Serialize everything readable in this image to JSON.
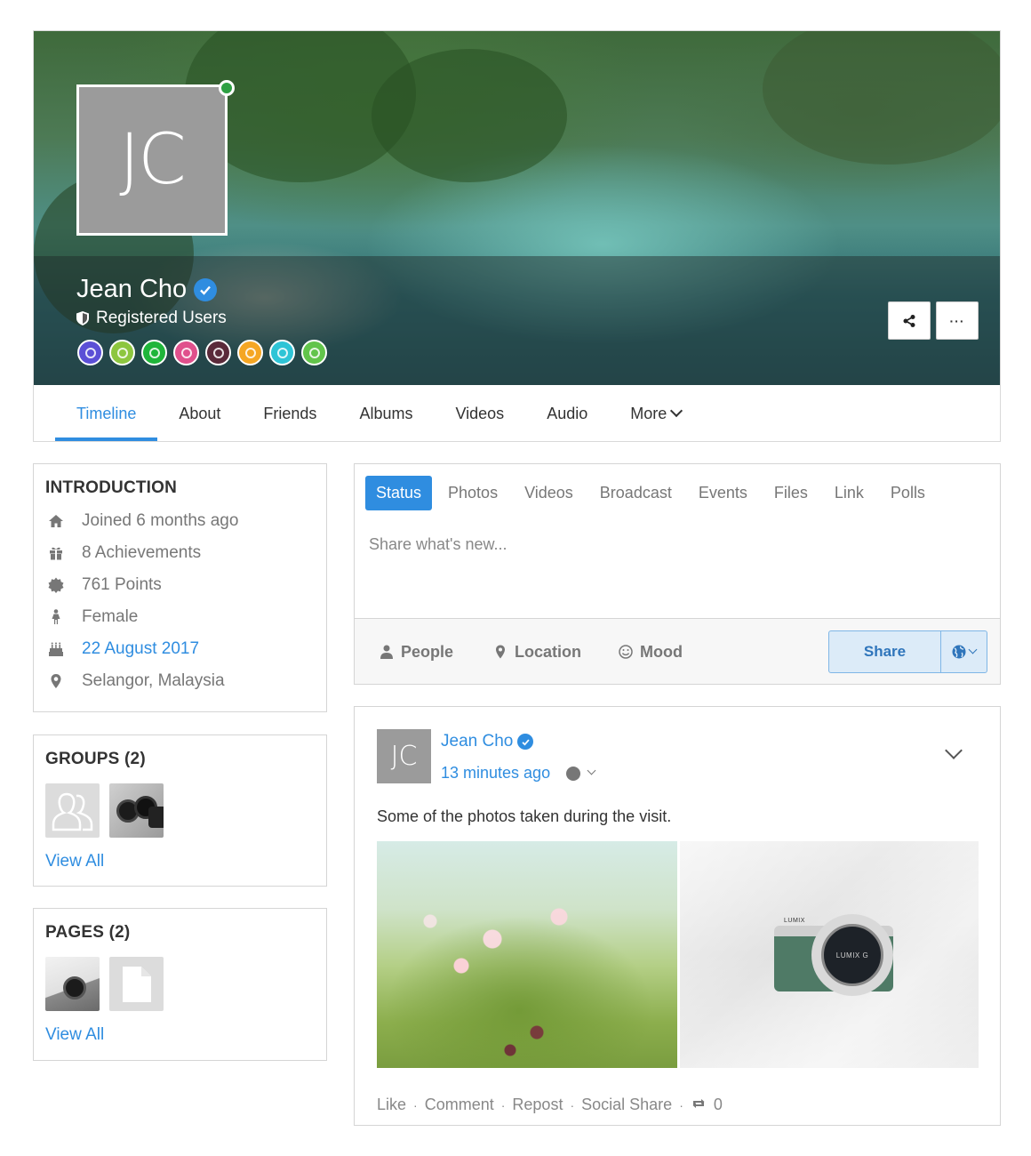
{
  "profile": {
    "initials": "JC",
    "name": "Jean Cho",
    "role": "Registered Users",
    "badge_colors": [
      "#5b4fd6",
      "#8dc63f",
      "#1fb53a",
      "#e0508c",
      "#5a2a3a",
      "#f5a623",
      "#2ec4d6",
      "#62c44b"
    ],
    "online_color": "#2ea043"
  },
  "cover_actions": {
    "share_icon": "share-icon",
    "more_label": "···"
  },
  "nav": {
    "tabs": [
      "Timeline",
      "About",
      "Friends",
      "Albums",
      "Videos",
      "Audio",
      "More"
    ],
    "active": "Timeline"
  },
  "introduction": {
    "title": "INTRODUCTION",
    "items": [
      {
        "icon": "home-icon",
        "text": "Joined 6 months ago"
      },
      {
        "icon": "gift-icon",
        "text": "8 Achievements"
      },
      {
        "icon": "badge-icon",
        "text": "761 Points"
      },
      {
        "icon": "female-icon",
        "text": "Female"
      },
      {
        "icon": "cake-icon",
        "text": "22 August 2017"
      },
      {
        "icon": "map-pin-icon",
        "text": "Selangor, Malaysia"
      }
    ]
  },
  "groups": {
    "title": "GROUPS (2)",
    "view_all": "View All"
  },
  "pages": {
    "title": "PAGES (2)",
    "view_all": "View All"
  },
  "composer": {
    "tabs": [
      "Status",
      "Photos",
      "Videos",
      "Broadcast",
      "Events",
      "Files",
      "Link",
      "Polls"
    ],
    "active_tab": "Status",
    "placeholder": "Share what's new...",
    "people_label": "People",
    "location_label": "Location",
    "mood_label": "Mood",
    "share_label": "Share"
  },
  "post": {
    "initials": "JC",
    "author": "Jean Cho",
    "time": "13 minutes ago",
    "text": "Some of the photos taken during the visit.",
    "camera_brand": "LUMIX",
    "camera_lens": "LUMIX G",
    "actions": {
      "like": "Like",
      "comment": "Comment",
      "repost": "Repost",
      "social_share": "Social Share",
      "repost_count": "0"
    }
  },
  "colors": {
    "accent": "#2f8de0",
    "muted_text": "#777777",
    "border": "#d5d5d5"
  }
}
